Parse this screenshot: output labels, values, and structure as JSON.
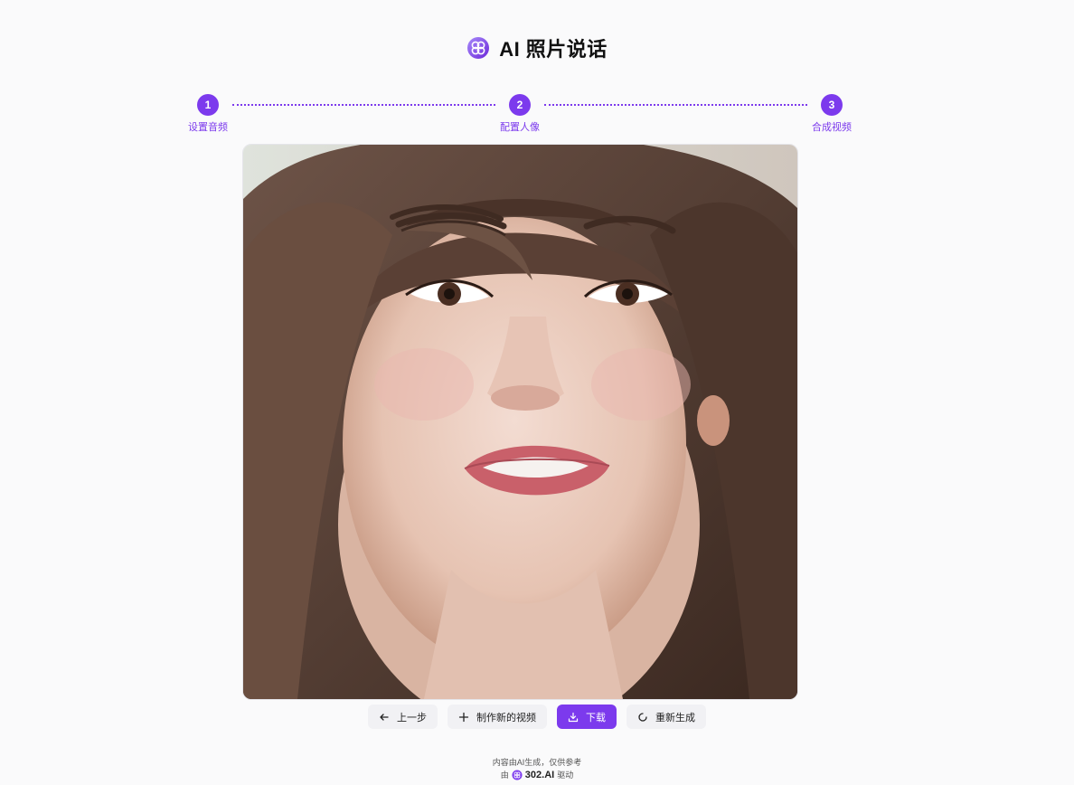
{
  "header": {
    "title": "AI 照片说话",
    "logo_icon": "302-logo-icon"
  },
  "steps": [
    {
      "number": "1",
      "label": "设置音频"
    },
    {
      "number": "2",
      "label": "配置人像"
    },
    {
      "number": "3",
      "label": "合成视频"
    }
  ],
  "accent_color": "#7c3aed",
  "actions": {
    "back_label": "上一步",
    "new_video_label": "制作新的视频",
    "download_label": "下载",
    "regenerate_label": "重新生成"
  },
  "footer": {
    "disclaimer": "内容由AI生成，仅供参考",
    "powered_prefix": "由",
    "brand": "302.AI",
    "powered_suffix": "驱动"
  }
}
